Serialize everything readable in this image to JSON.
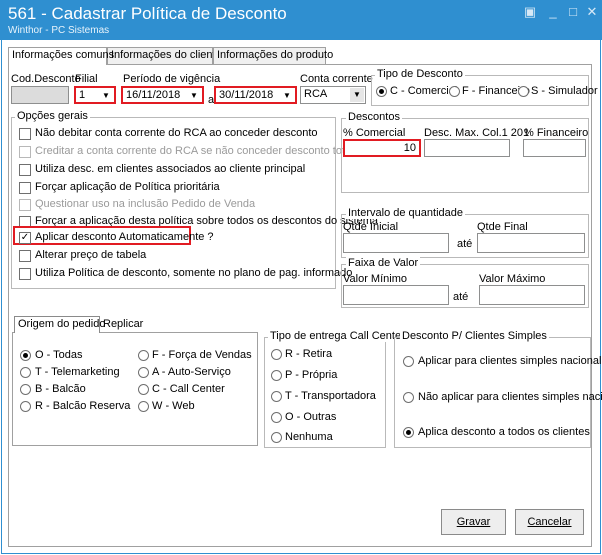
{
  "window": {
    "title": "561 - Cadastrar Política de Desconto",
    "subtitle": "Winthor - PC Sistemas",
    "controls": {
      "restore": "▣",
      "minimize": "_",
      "maximize": "□",
      "close": "✕"
    }
  },
  "tabs": [
    "Informações comuns",
    "Informações do cliente",
    "Informações do produto"
  ],
  "header": {
    "cod_desconto_label": "Cod.Desconto",
    "filial_label": "Filial",
    "filial_value": "1",
    "periodo_label": "Período de vigência",
    "data_inicio": "16/11/2018",
    "a_label": "a",
    "data_fim": "30/11/2018",
    "conta_label": "Conta corrente",
    "conta_value": "RCA",
    "tipo_label": "Tipo de Desconto",
    "tipo_options": [
      "C - Comercial",
      "F - Financeiro",
      "S - Simulador"
    ]
  },
  "opcoes_gerais": {
    "title": "Opções gerais",
    "items": [
      {
        "label": "Não debitar conta corrente do RCA ao conceder desconto",
        "checked": false,
        "enabled": true
      },
      {
        "label": "Creditar a conta corrente do RCA se não conceder desconto total",
        "checked": false,
        "enabled": false
      },
      {
        "label": "Utiliza desc. em clientes associados ao cliente principal",
        "checked": false,
        "enabled": true
      },
      {
        "label": "Forçar aplicação de Política prioritária",
        "checked": false,
        "enabled": true
      },
      {
        "label": "Questionar uso na inclusão Pedido de Venda",
        "checked": false,
        "enabled": false
      },
      {
        "label": "Forçar a aplicação desta política sobre todos os descontos do sistema",
        "checked": false,
        "enabled": true
      },
      {
        "label": "Aplicar desconto Automaticamente ?",
        "checked": true,
        "enabled": true
      },
      {
        "label": "Alterar preço de tabela",
        "checked": false,
        "enabled": true
      },
      {
        "label": "Utiliza Política de desconto, somente no plano de pag. informado",
        "checked": false,
        "enabled": true
      }
    ]
  },
  "descontos": {
    "title": "Descontos",
    "comercial_label": "% Comercial",
    "comercial_value": "10",
    "max_label": "Desc. Max. Col.1 201",
    "financeiro_label": "% Financeiro"
  },
  "intervalo": {
    "title": "Intervalo de quantidade",
    "inicial_label": "Qtde Inicial",
    "ate": "até",
    "final_label": "Qtde Final"
  },
  "faixa": {
    "title": "Faixa de Valor",
    "min_label": "Valor Mínimo",
    "ate": "até",
    "max_label": "Valor Máximo"
  },
  "lower_tabs": [
    "Origem do pedido",
    "Replicar"
  ],
  "origem": {
    "col1": [
      "O - Todas",
      "T - Telemarketing",
      "B - Balcão",
      "R - Balcão Reserva"
    ],
    "col2": [
      "F - Força de Vendas",
      "A - Auto-Serviço",
      "C - Call Center",
      "W - Web"
    ]
  },
  "entrega": {
    "title": "Tipo de entrega Call Center",
    "options": [
      "R - Retira",
      "P - Própria",
      "T - Transportadora",
      "O - Outras",
      "Nenhuma"
    ]
  },
  "clientes_simples": {
    "title": "Desconto P/ Clientes Simples",
    "options": [
      "Aplicar para clientes simples nacional",
      "Não aplicar para clientes simples nacional",
      "Aplica desconto a todos os clientes"
    ]
  },
  "buttons": {
    "gravar": "Gravar",
    "cancelar": "Cancelar"
  },
  "colors": {
    "titlebar": "#2f8fd0",
    "highlight": "#e11b22",
    "disabled_field": "#dcdcdc"
  }
}
